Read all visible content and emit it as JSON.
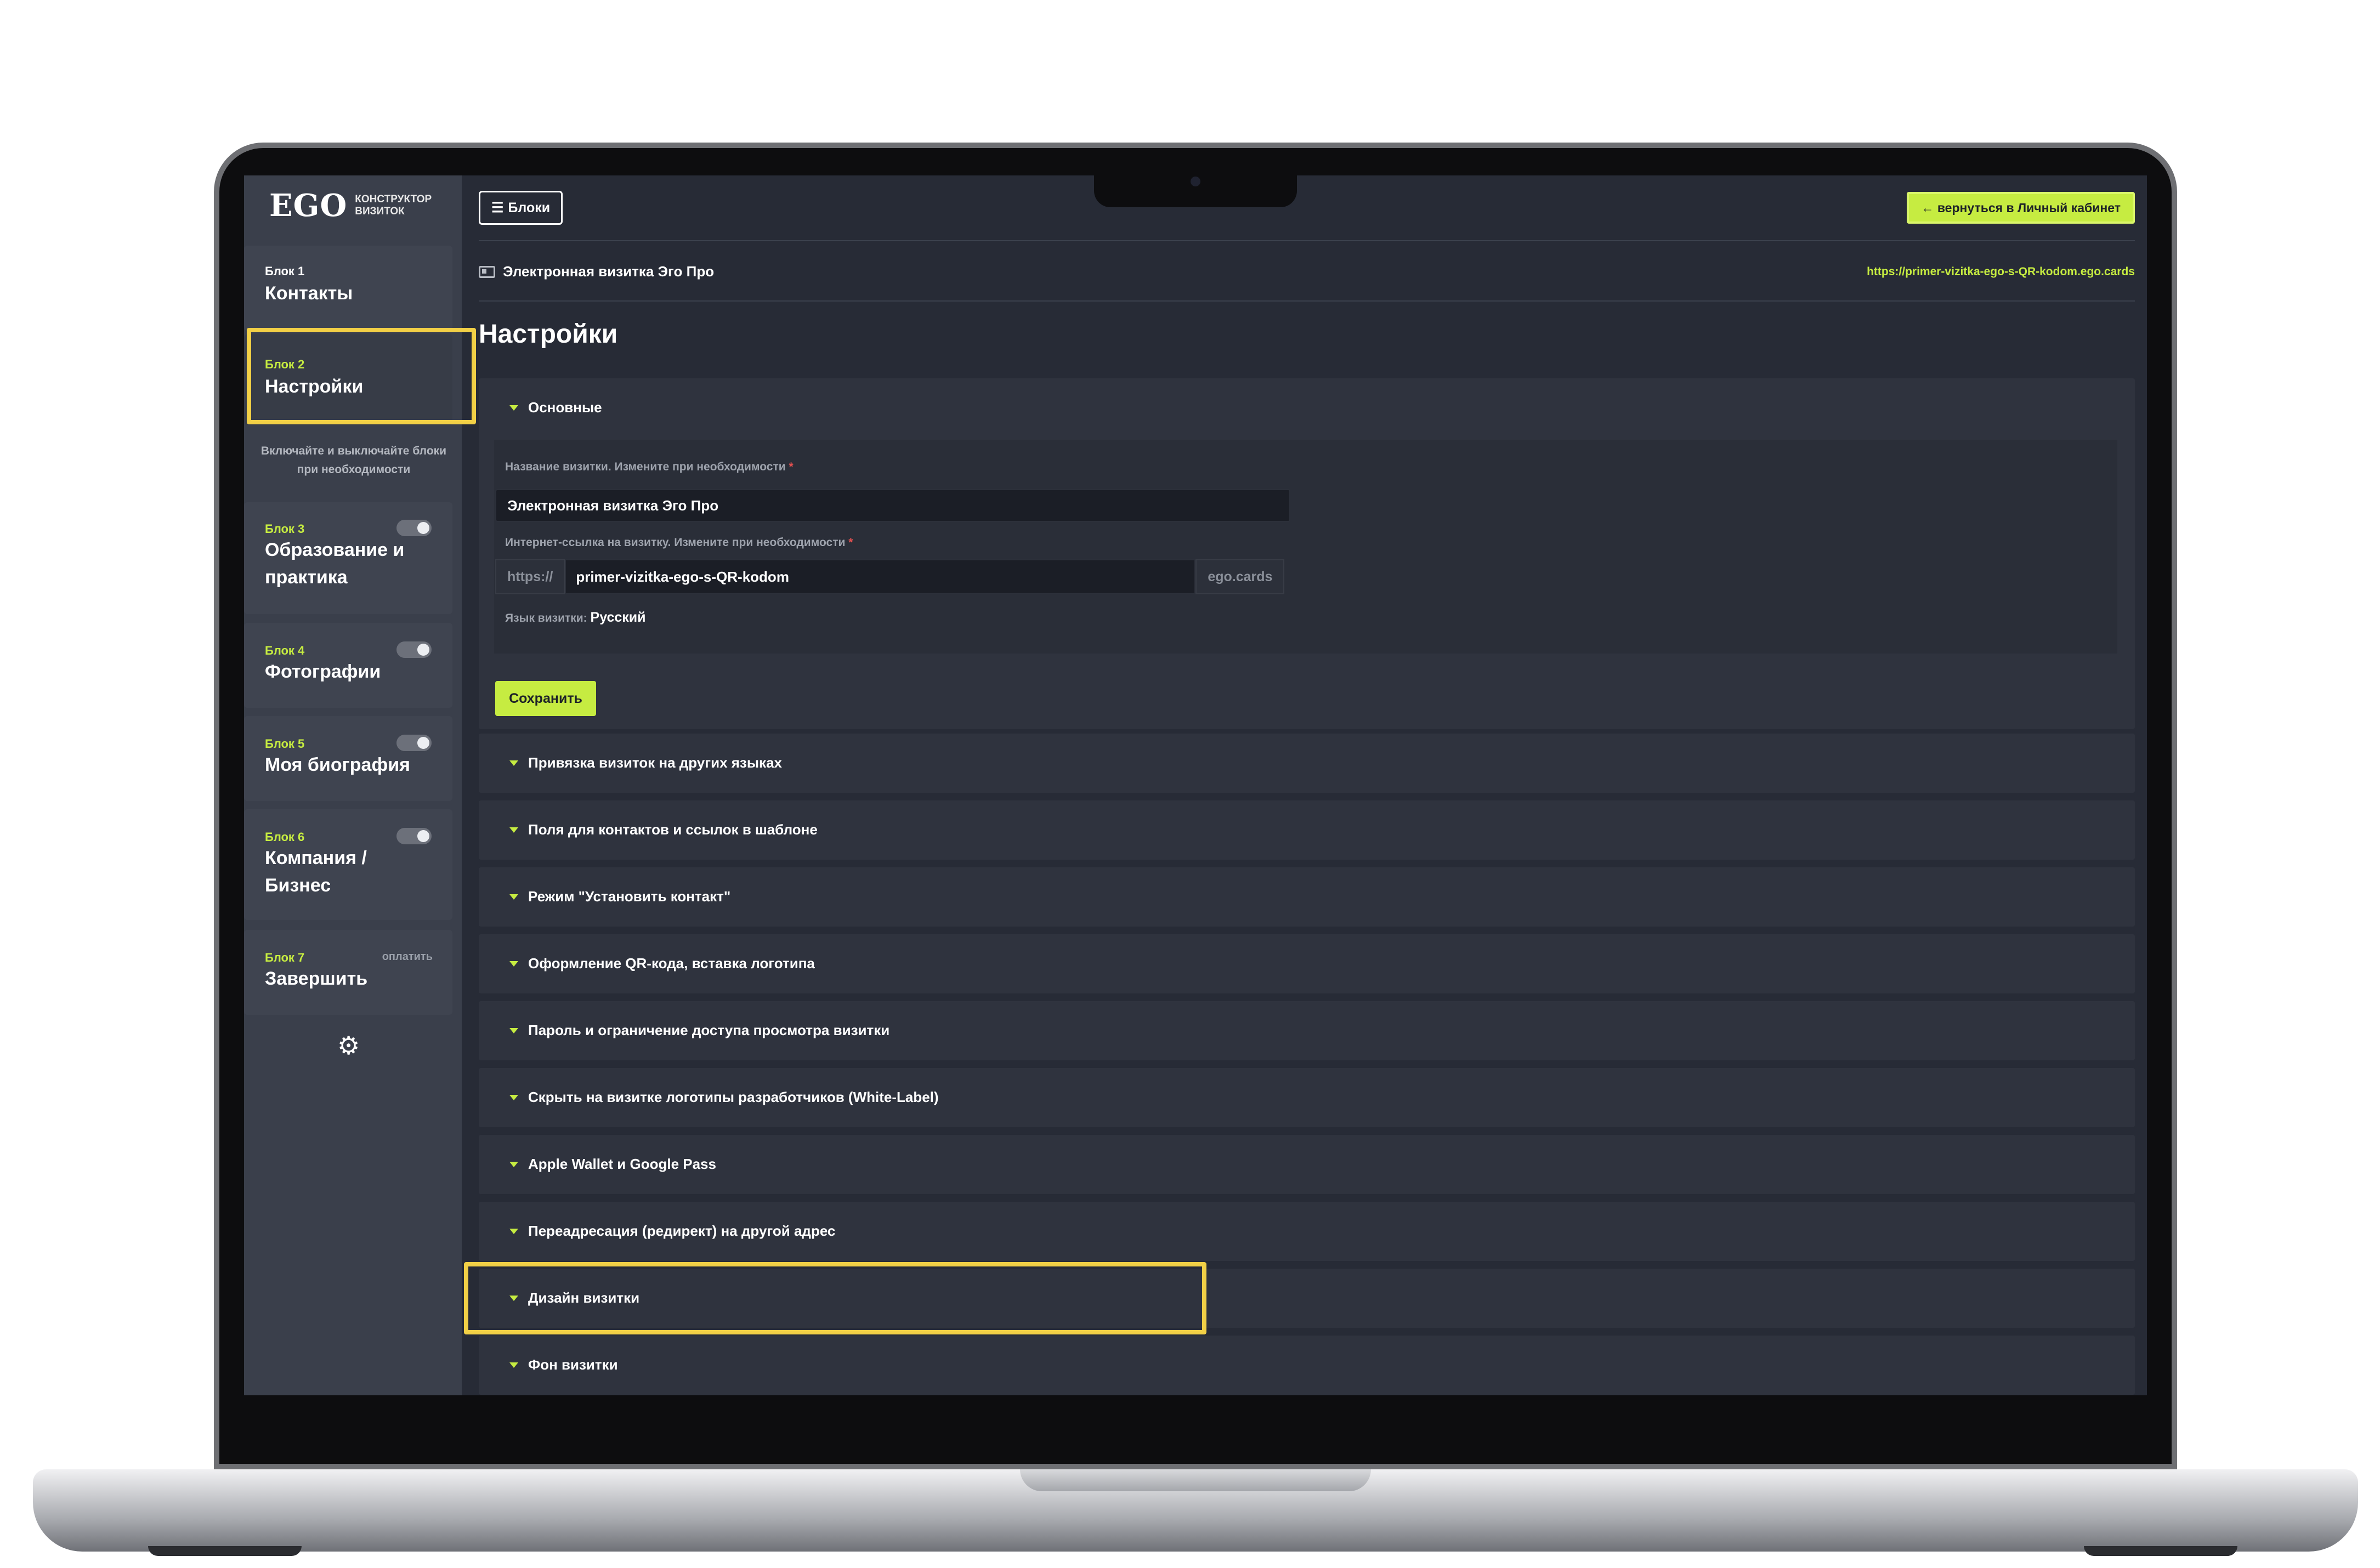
{
  "app": {
    "logo": "EGO",
    "logo_subtitle": "КОНСТРУКТОР ВИЗИТОК"
  },
  "sidebar": {
    "blocks": [
      {
        "num": "Блок 1",
        "title": "Контакты"
      },
      {
        "num": "Блок 2",
        "title": "Настройки"
      },
      {
        "num": "Блок 3",
        "title": "Образование и практика"
      },
      {
        "num": "Блок 4",
        "title": "Фотографии"
      },
      {
        "num": "Блок 5",
        "title": "Моя биография"
      },
      {
        "num": "Блок 6",
        "title": "Компания / Бизнес"
      },
      {
        "num": "Блок 7",
        "title": "Завершить",
        "badge": "оплатить"
      }
    ],
    "hint": "Включайте и выключайте блоки при необходимости",
    "settings_icon": "gear-icon"
  },
  "header": {
    "blocks_button": "Блоки",
    "back_button": "← вернуться в Личный кабинет",
    "card_name": "Электронная визитка Эго Про",
    "card_link": "https://primer-vizitka-ego-s-QR-kodom.ego.cards"
  },
  "page": {
    "title": "Настройки"
  },
  "basic": {
    "title": "Основные",
    "name_label": "Название визитки. Измените при необходимости",
    "name_value": "Электронная визитка Эго Про",
    "url_label": "Интернет-ссылка на визитку. Измените при необходимости",
    "required_mark": "*",
    "url_prefix": "https://",
    "url_value": "primer-vizitka-ego-s-QR-kodom",
    "url_suffix": "ego.cards",
    "lang_label": "Язык визитки:",
    "lang_value": "Русский",
    "save_button": "Сохранить"
  },
  "sections": [
    "Привязка визиток на других языках",
    "Поля для контактов и ссылок в шаблоне",
    "Режим \"Установить контакт\"",
    "Оформление QR-кода, вставка логотипа",
    "Пароль и ограничение доступа просмотра визитки",
    "Скрыть на визитке логотипы разработчиков (White-Label)",
    "Apple Wallet и Google Pass",
    "Переадресация (редирект) на другой адрес",
    "Дизайн визитки",
    "Фон визитки"
  ],
  "colors": {
    "accent": "#c6ec41",
    "highlight": "#f2d046",
    "background": "#272b36",
    "sidebar": "#3a3f4b"
  }
}
